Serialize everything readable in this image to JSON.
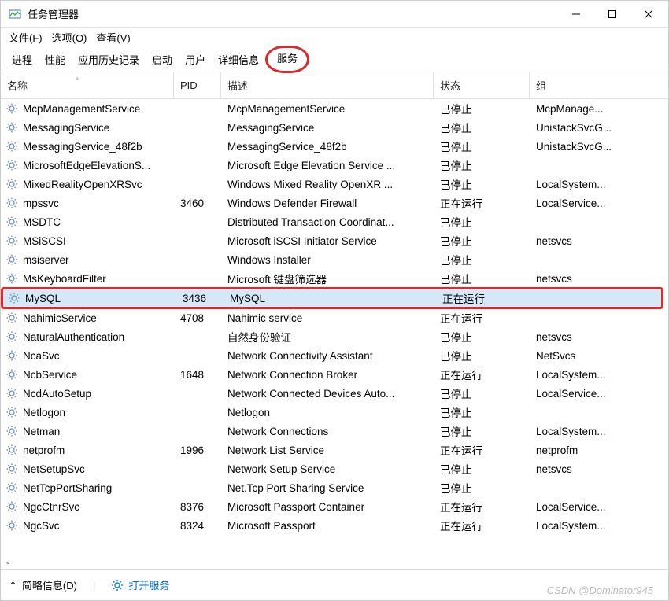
{
  "window": {
    "title": "任务管理器"
  },
  "menu": {
    "file": "文件(F)",
    "options": "选项(O)",
    "view": "查看(V)"
  },
  "tabs": [
    "进程",
    "性能",
    "应用历史记录",
    "启动",
    "用户",
    "详细信息",
    "服务"
  ],
  "active_tab_index": 6,
  "columns": {
    "name": "名称",
    "pid": "PID",
    "desc": "描述",
    "status": "状态",
    "group": "组"
  },
  "services": [
    {
      "name": "McpManagementService",
      "pid": "",
      "desc": "McpManagementService",
      "status": "已停止",
      "group": "McpManage..."
    },
    {
      "name": "MessagingService",
      "pid": "",
      "desc": "MessagingService",
      "status": "已停止",
      "group": "UnistackSvcG..."
    },
    {
      "name": "MessagingService_48f2b",
      "pid": "",
      "desc": "MessagingService_48f2b",
      "status": "已停止",
      "group": "UnistackSvcG..."
    },
    {
      "name": "MicrosoftEdgeElevationS...",
      "pid": "",
      "desc": "Microsoft Edge Elevation Service ...",
      "status": "已停止",
      "group": ""
    },
    {
      "name": "MixedRealityOpenXRSvc",
      "pid": "",
      "desc": "Windows Mixed Reality OpenXR ...",
      "status": "已停止",
      "group": "LocalSystem..."
    },
    {
      "name": "mpssvc",
      "pid": "3460",
      "desc": "Windows Defender Firewall",
      "status": "正在运行",
      "group": "LocalService..."
    },
    {
      "name": "MSDTC",
      "pid": "",
      "desc": "Distributed Transaction Coordinat...",
      "status": "已停止",
      "group": ""
    },
    {
      "name": "MSiSCSI",
      "pid": "",
      "desc": "Microsoft iSCSI Initiator Service",
      "status": "已停止",
      "group": "netsvcs"
    },
    {
      "name": "msiserver",
      "pid": "",
      "desc": "Windows Installer",
      "status": "已停止",
      "group": ""
    },
    {
      "name": "MsKeyboardFilter",
      "pid": "",
      "desc": "Microsoft 键盘筛选器",
      "status": "已停止",
      "group": "netsvcs"
    },
    {
      "name": "MySQL",
      "pid": "3436",
      "desc": "MySQL",
      "status": "正在运行",
      "group": ""
    },
    {
      "name": "NahimicService",
      "pid": "4708",
      "desc": "Nahimic service",
      "status": "正在运行",
      "group": ""
    },
    {
      "name": "NaturalAuthentication",
      "pid": "",
      "desc": "自然身份验证",
      "status": "已停止",
      "group": "netsvcs"
    },
    {
      "name": "NcaSvc",
      "pid": "",
      "desc": "Network Connectivity Assistant",
      "status": "已停止",
      "group": "NetSvcs"
    },
    {
      "name": "NcbService",
      "pid": "1648",
      "desc": "Network Connection Broker",
      "status": "正在运行",
      "group": "LocalSystem..."
    },
    {
      "name": "NcdAutoSetup",
      "pid": "",
      "desc": "Network Connected Devices Auto...",
      "status": "已停止",
      "group": "LocalService..."
    },
    {
      "name": "Netlogon",
      "pid": "",
      "desc": "Netlogon",
      "status": "已停止",
      "group": ""
    },
    {
      "name": "Netman",
      "pid": "",
      "desc": "Network Connections",
      "status": "已停止",
      "group": "LocalSystem..."
    },
    {
      "name": "netprofm",
      "pid": "1996",
      "desc": "Network List Service",
      "status": "正在运行",
      "group": "netprofm"
    },
    {
      "name": "NetSetupSvc",
      "pid": "",
      "desc": "Network Setup Service",
      "status": "已停止",
      "group": "netsvcs"
    },
    {
      "name": "NetTcpPortSharing",
      "pid": "",
      "desc": "Net.Tcp Port Sharing Service",
      "status": "已停止",
      "group": ""
    },
    {
      "name": "NgcCtnrSvc",
      "pid": "8376",
      "desc": "Microsoft Passport Container",
      "status": "正在运行",
      "group": "LocalService..."
    },
    {
      "name": "NgcSvc",
      "pid": "8324",
      "desc": "Microsoft Passport",
      "status": "正在运行",
      "group": "LocalSystem..."
    }
  ],
  "highlight_row_index": 10,
  "footer": {
    "brief": "简略信息(D)",
    "open_services": "打开服务"
  },
  "watermark": "CSDN @Dominator945"
}
